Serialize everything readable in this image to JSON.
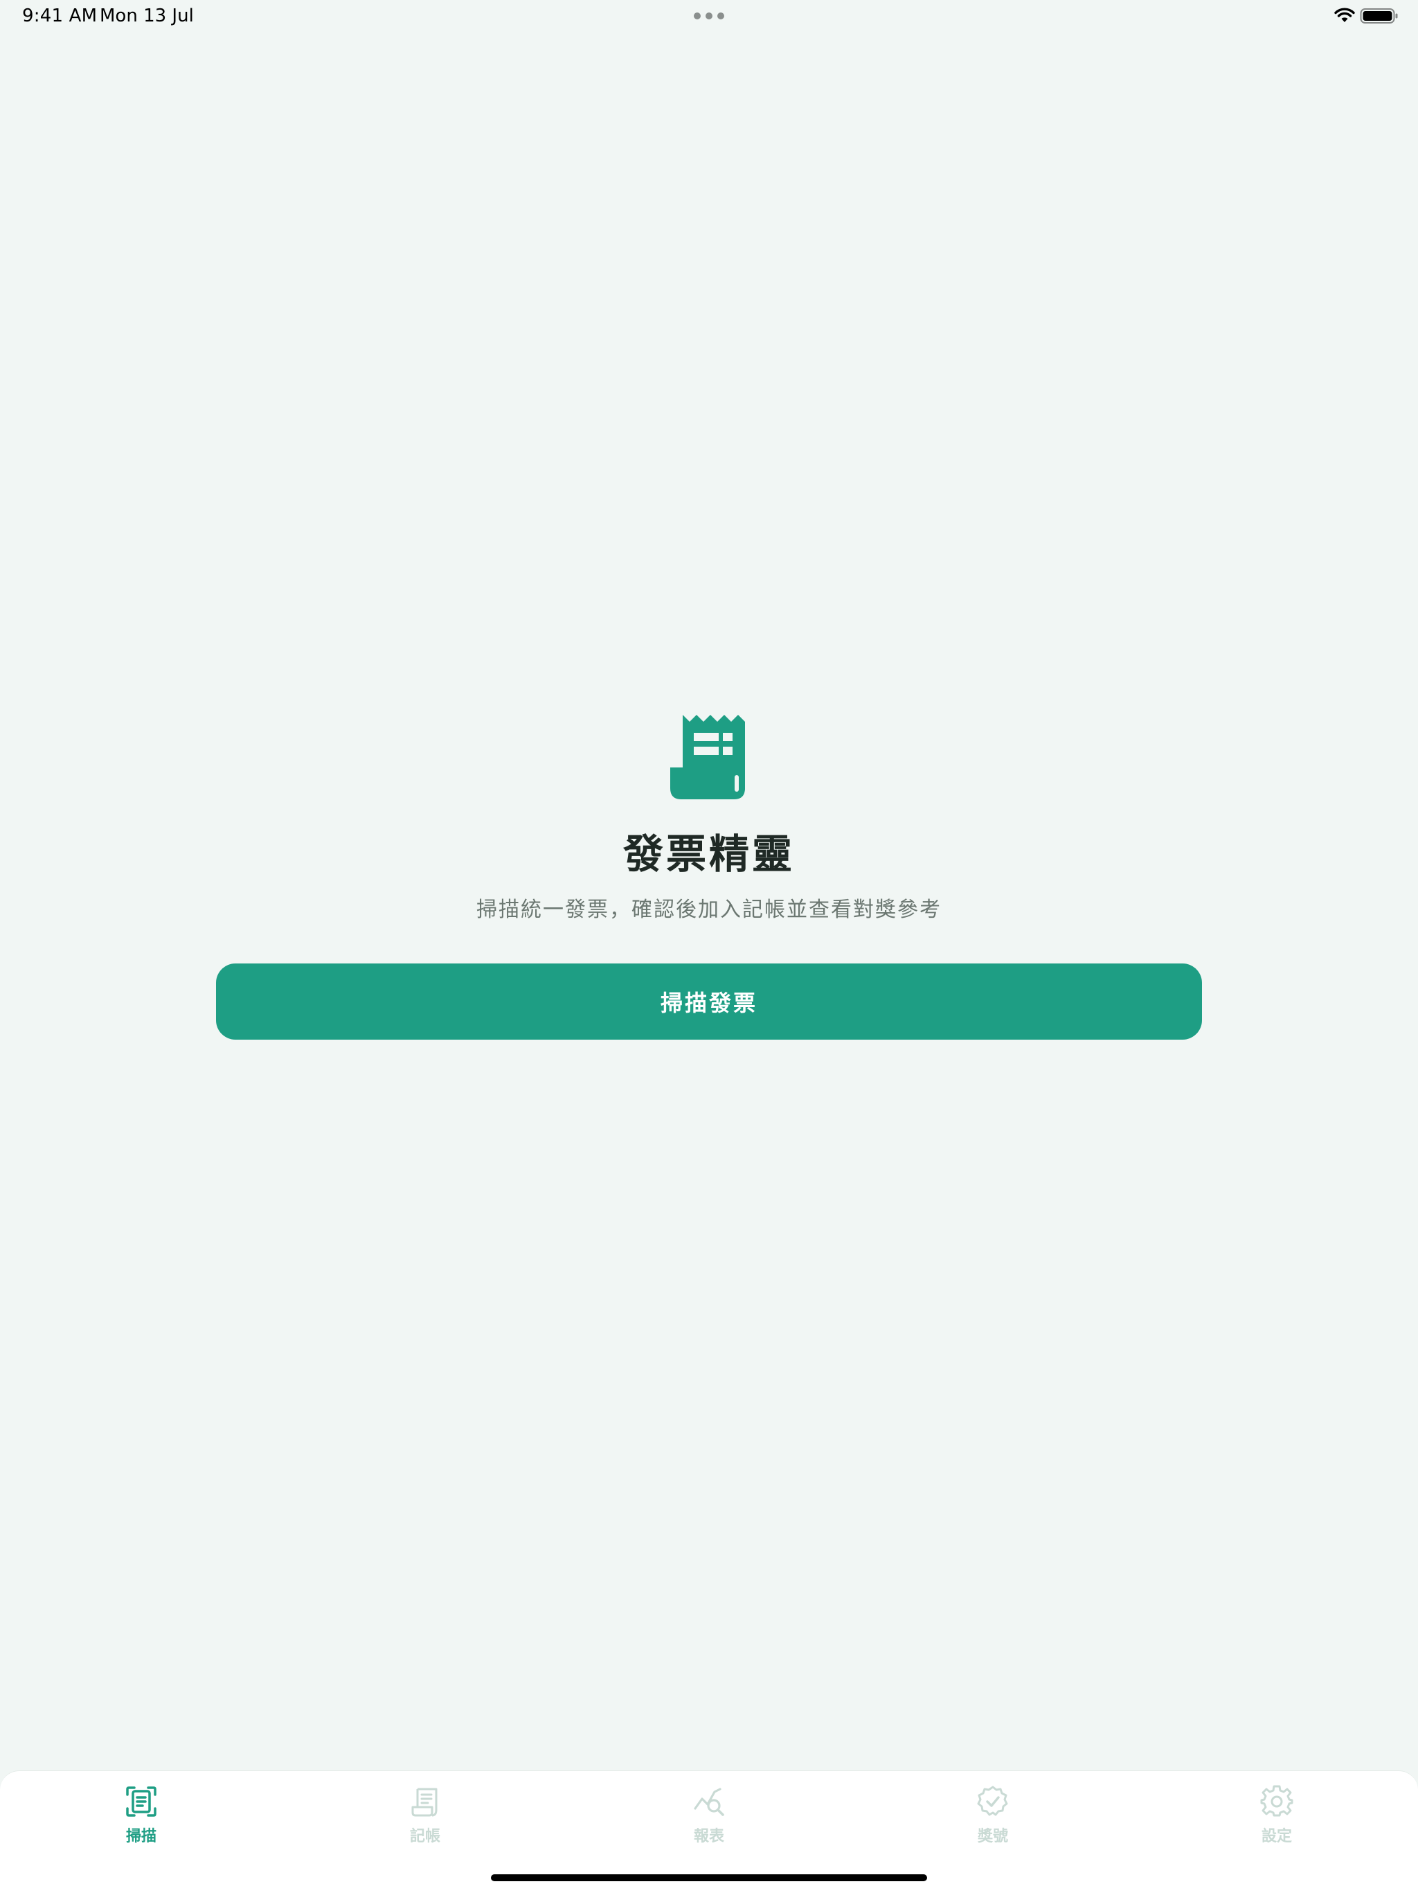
{
  "status_bar": {
    "time": "9:41 AM",
    "date": "Mon 13 Jul",
    "wifi_icon": "wifi-icon",
    "battery_icon": "battery-full-icon"
  },
  "hero": {
    "icon": "receipt-icon",
    "title": "發票精靈",
    "subtitle": "掃描統一發票，確認後加入記帳並查看對獎參考",
    "scan_button_label": "掃描發票"
  },
  "tab_bar": {
    "active_index": 0,
    "items": [
      {
        "label": "掃描",
        "icon": "scan-document-icon"
      },
      {
        "label": "記帳",
        "icon": "ledger-icon"
      },
      {
        "label": "報表",
        "icon": "chart-search-icon"
      },
      {
        "label": "獎號",
        "icon": "check-badge-icon"
      },
      {
        "label": "設定",
        "icon": "gear-icon"
      }
    ]
  },
  "colors": {
    "accent": "#1e9e84",
    "background": "#f1f6f4",
    "inactive_tab": "#c9dad4"
  }
}
